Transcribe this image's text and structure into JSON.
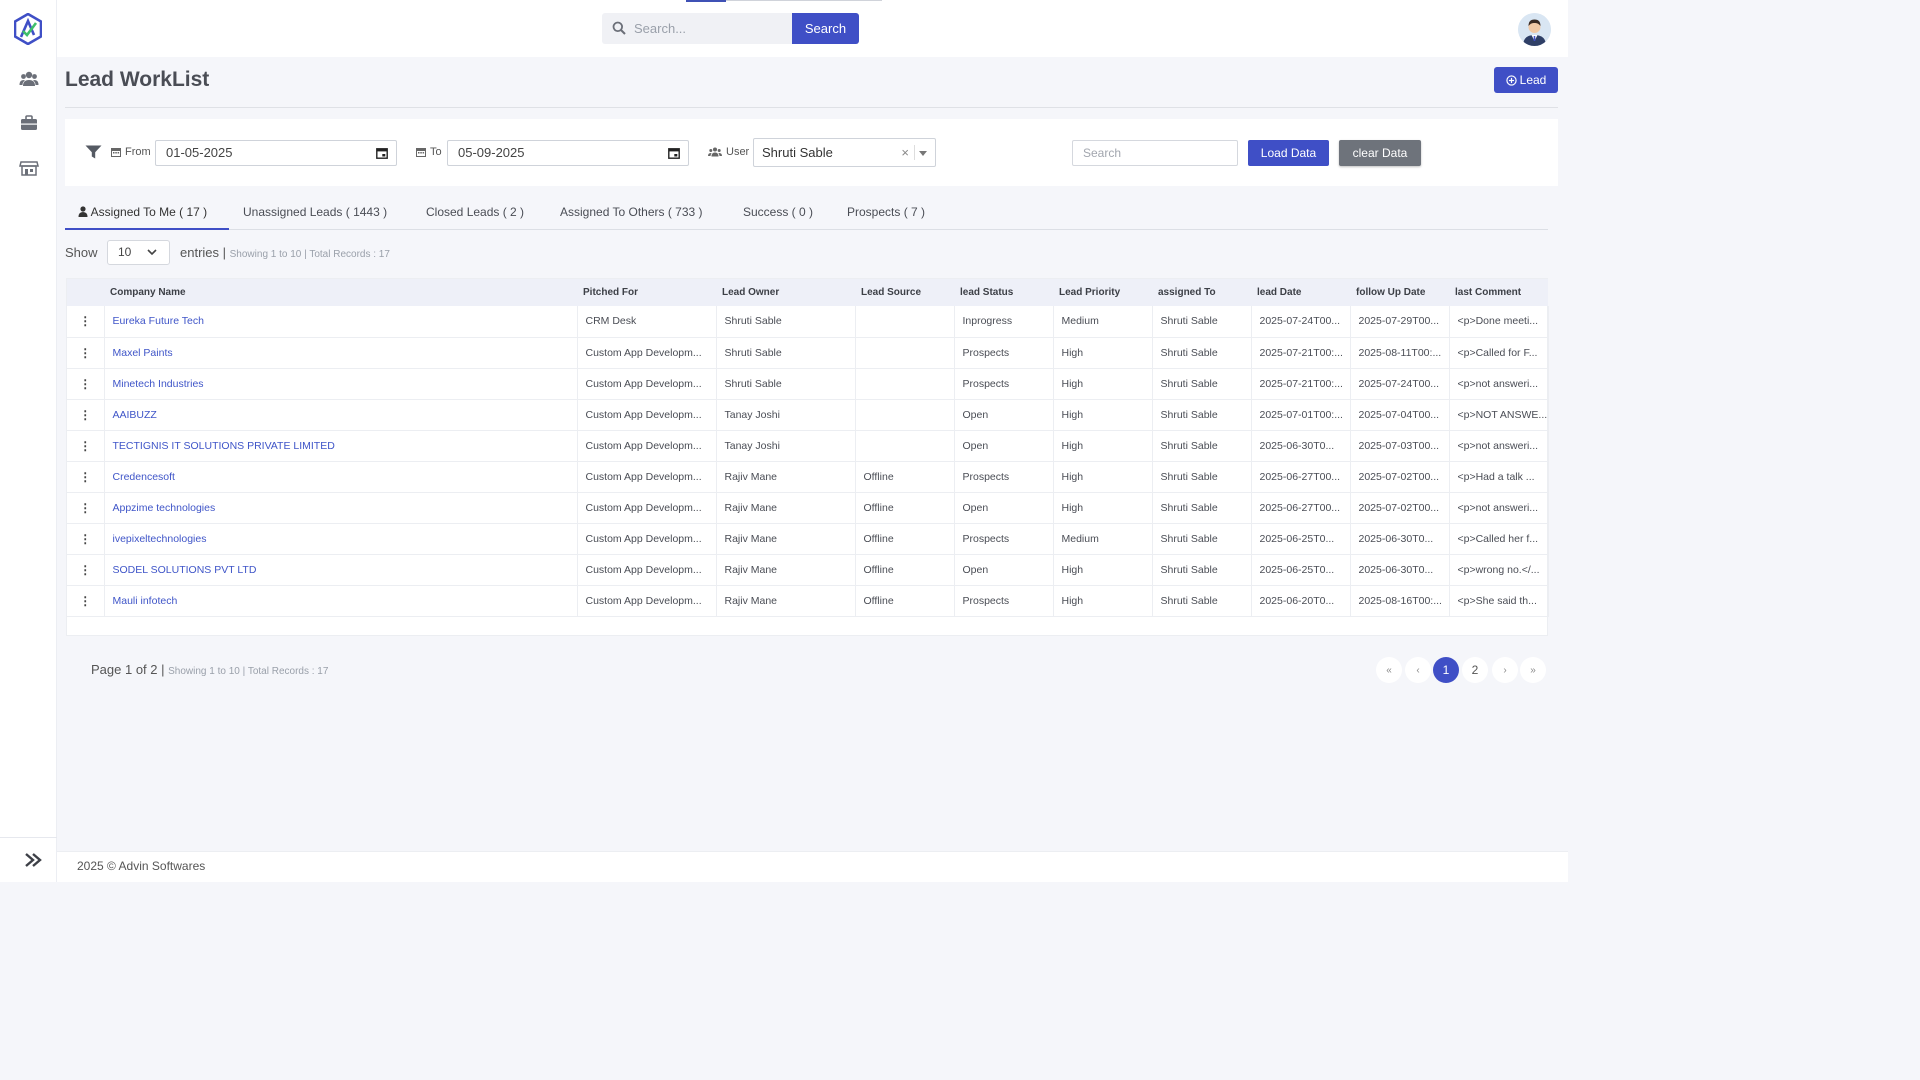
{
  "topbar": {
    "search_placeholder": "Search...",
    "search_button": "Search"
  },
  "page": {
    "title": "Lead WorkList",
    "add_button": "Lead"
  },
  "filters": {
    "from_label": "From",
    "from_value": "01-05-2025",
    "to_label": "To",
    "to_value": "05-09-2025",
    "user_label": "User",
    "user_value": "Shruti Sable",
    "search_placeholder": "Search",
    "load_button": "Load Data",
    "clear_button": "clear Data"
  },
  "tabs": [
    {
      "label": "Assigned To Me ( 17 )",
      "active": true
    },
    {
      "label": "Unassigned Leads ( 1443 )",
      "active": false
    },
    {
      "label": "Closed Leads ( 2 )",
      "active": false
    },
    {
      "label": "Assigned To Others ( 733 )",
      "active": false
    },
    {
      "label": "Success ( 0 )",
      "active": false
    },
    {
      "label": "Prospects ( 7 )",
      "active": false
    }
  ],
  "entries": {
    "show_label": "Show",
    "value": "10",
    "entries_label": "entries |",
    "info": "Showing 1 to 10 | Total Records : 17"
  },
  "table": {
    "columns": [
      "",
      "Company Name",
      "Pitched For",
      "Lead Owner",
      "Lead Source",
      "lead Status",
      "Lead Priority",
      "assigned To",
      "lead Date",
      "follow Up Date",
      "last Comment"
    ],
    "rows": [
      [
        "⋮",
        "Eureka Future Tech",
        "CRM Desk",
        "Shruti Sable",
        "",
        "Inprogress",
        "Medium",
        "Shruti Sable",
        "2025-07-24T00...",
        "2025-07-29T00...",
        "<p>Done meeti..."
      ],
      [
        "⋮",
        "Maxel Paints",
        "Custom App Developm...",
        "Shruti Sable",
        "",
        "Prospects",
        "High",
        "Shruti Sable",
        "2025-07-21T00:...",
        "2025-08-11T00:...",
        "<p>Called for F..."
      ],
      [
        "⋮",
        "Minetech Industries",
        "Custom App Developm...",
        "Shruti Sable",
        "",
        "Prospects",
        "High",
        "Shruti Sable",
        "2025-07-21T00:...",
        "2025-07-24T00...",
        "<p>not answeri..."
      ],
      [
        "⋮",
        "AAIBUZZ",
        "Custom App Developm...",
        "Tanay Joshi",
        "",
        "Open",
        "High",
        "Shruti Sable",
        "2025-07-01T00:...",
        "2025-07-04T00...",
        "<p>NOT ANSWE..."
      ],
      [
        "⋮",
        "TECTIGNIS IT SOLUTIONS PRIVATE LIMITED",
        "Custom App Developm...",
        "Tanay Joshi",
        "",
        "Open",
        "High",
        "Shruti Sable",
        "2025-06-30T0...",
        "2025-07-03T00...",
        "<p>not answeri..."
      ],
      [
        "⋮",
        "Credencesoft",
        "Custom App Developm...",
        "Rajiv Mane",
        "Offline",
        "Prospects",
        "High",
        "Shruti Sable",
        "2025-06-27T00...",
        "2025-07-02T00...",
        "<p>Had a talk ..."
      ],
      [
        "⋮",
        "Appzime technologies",
        "Custom App Developm...",
        "Rajiv Mane",
        "Offline",
        "Open",
        "High",
        "Shruti Sable",
        "2025-06-27T00...",
        "2025-07-02T00...",
        "<p>not answeri..."
      ],
      [
        "⋮",
        "ivepixeltechnologies",
        "Custom App Developm...",
        "Rajiv Mane",
        "Offline",
        "Prospects",
        "Medium",
        "Shruti Sable",
        "2025-06-25T0...",
        "2025-06-30T0...",
        "<p>Called her f..."
      ],
      [
        "⋮",
        "SODEL SOLUTIONS PVT LTD",
        "Custom App Developm...",
        "Rajiv Mane",
        "Offline",
        "Open",
        "High",
        "Shruti Sable",
        "2025-06-25T0...",
        "2025-06-30T0...",
        "<p>wrong no.</..."
      ],
      [
        "⋮",
        "Mauli infotech",
        "Custom App Developm...",
        "Rajiv Mane",
        "Offline",
        "Prospects",
        "High",
        "Shruti Sable",
        "2025-06-20T0...",
        "2025-08-16T00:...",
        "<p>She said th..."
      ]
    ]
  },
  "pagination": {
    "page_text": "Page 1 of 2 |",
    "info": "Showing 1 to 10 | Total Records : 17",
    "first": "«",
    "prev": "‹",
    "pages": [
      "1",
      "2"
    ],
    "next": "›",
    "last": "»"
  },
  "footer": {
    "text": "2025 © Advin Softwares"
  },
  "colors": {
    "primary": "#3f4fc6",
    "link": "#3f55c8",
    "background": "#f5f6fa"
  }
}
